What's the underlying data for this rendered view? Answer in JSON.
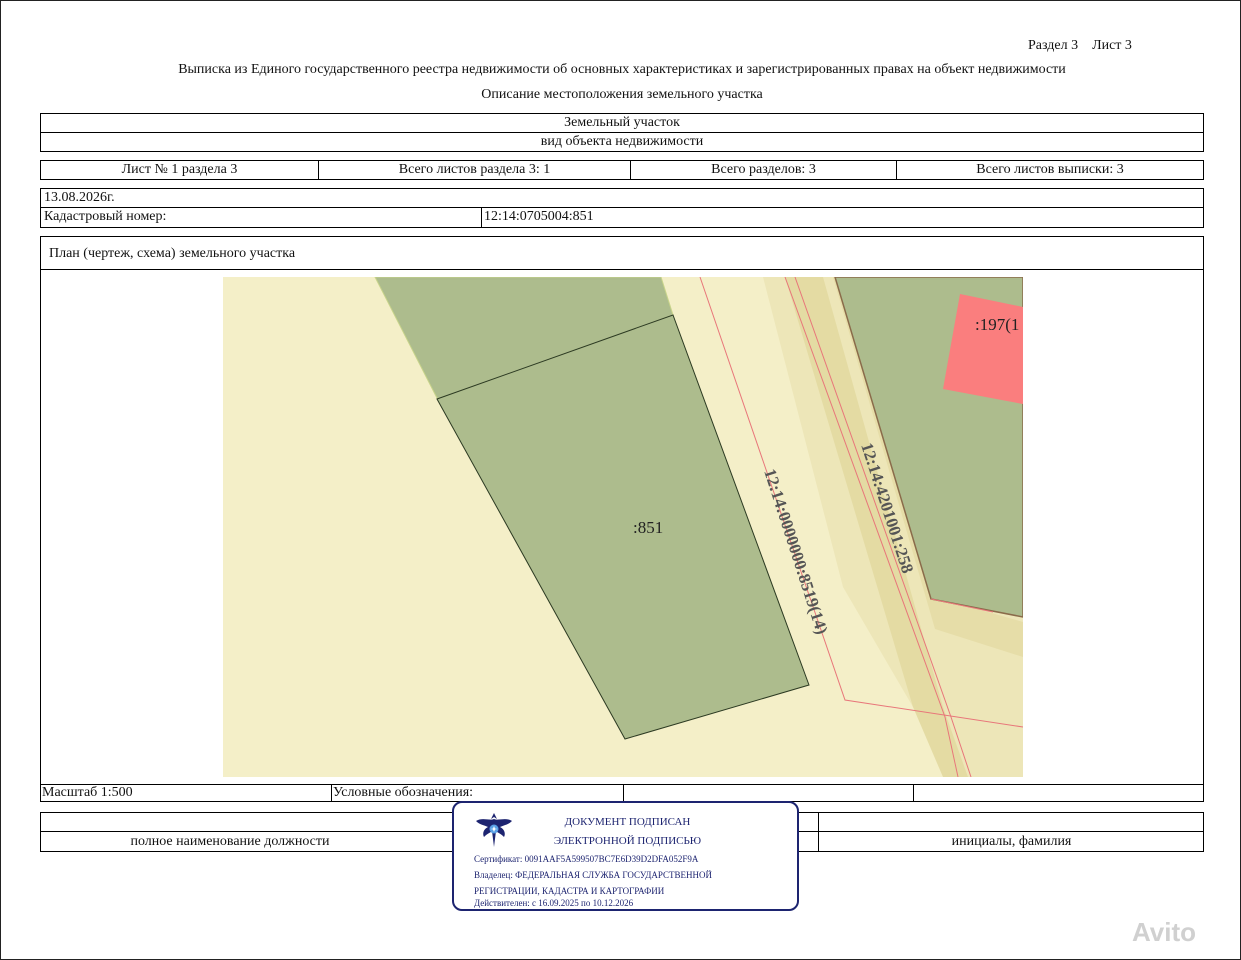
{
  "header": {
    "section_sheet": "Раздел 3    Лист 3",
    "title": "Выписка из Единого государственного реестра недвижимости об основных характеристиках и зарегистрированных правах на объект недвижимости",
    "subtitle": "Описание местоположения земельного участка"
  },
  "object": {
    "type": "Земельный участок",
    "type_caption": "вид объекта недвижимости"
  },
  "sheets": {
    "sheet_no": "Лист № 1 раздела 3",
    "total_sheets_section": "Всего листов раздела 3: 1",
    "total_sections": "Всего разделов: 3",
    "total_sheets_extract": "Всего листов выписки: 3"
  },
  "date": "13.08.2026г.",
  "cadastral": {
    "label": "Кадастровый номер:",
    "value": "12:14:0705004:851"
  },
  "plan": {
    "title": "План (чертеж, схема) земельного участка",
    "labels": {
      "main_parcel": ":851",
      "parcel_197": ":197(1",
      "road_1": "12:14:0000000:8519(14)",
      "road_2": "12:14:4201001:258"
    },
    "colors": {
      "background": "#f4efc8",
      "parcel_fill": "#adbc8d",
      "highlight_fill": "#fa7e7e",
      "road_fill": "#e6dda8",
      "boundary_red": "#e8767a"
    }
  },
  "legend": {
    "scale": "Масштаб 1:500",
    "legend_label": "Условные обозначения:"
  },
  "signature": {
    "position_caption": "полное наименование должности",
    "name_caption": "инициалы, фамилия"
  },
  "stamp": {
    "line1": "ДОКУМЕНТ ПОДПИСАН",
    "line2": "ЭЛЕКТРОННОЙ ПОДПИСЬЮ",
    "certificate": "Сертификат: 0091AAF5A599507BC7E6D39D2DFA052F9A",
    "owner1": "Владелец: ФЕДЕРАЛЬНАЯ СЛУЖБА ГОСУДАРСТВЕННОЙ",
    "owner2": "РЕГИСТРАЦИИ, КАДАСТРА И КАРТОГРАФИИ",
    "valid": "Действителен: с 16.09.2025 по 10.12.2026",
    "emblem": "eagle-emblem-icon"
  },
  "watermark": "Avito"
}
